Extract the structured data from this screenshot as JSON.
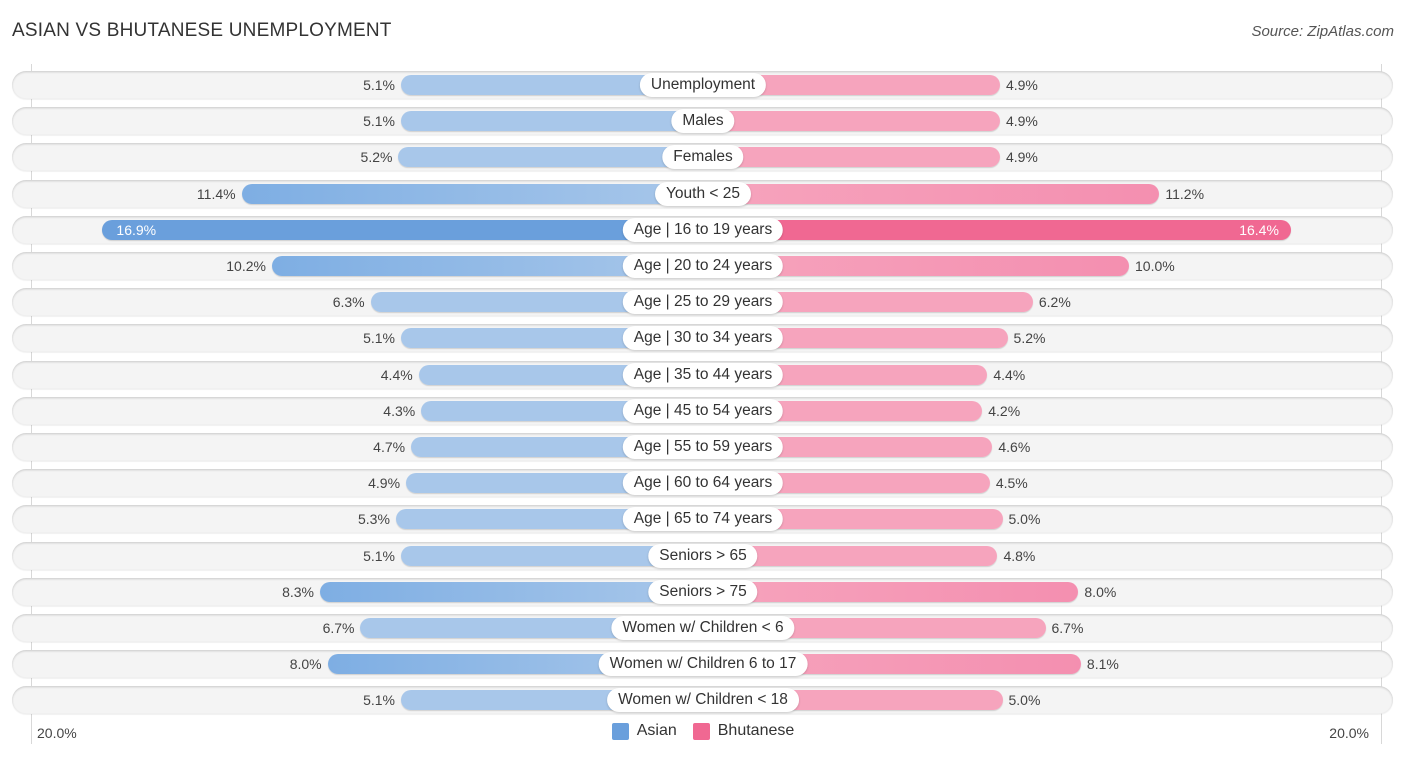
{
  "header": {
    "title": "ASIAN VS BHUTANESE UNEMPLOYMENT",
    "source": "Source: ZipAtlas.com"
  },
  "colors": {
    "asian": "#6a9fdc",
    "asian_light": "#a8c7ea",
    "bhutanese": "#f06892",
    "bhutanese_light": "#f6a4bd"
  },
  "chart_data": {
    "type": "bar",
    "orientation": "horizontal-diverging",
    "title": "ASIAN VS BHUTANESE UNEMPLOYMENT",
    "xlabel": "",
    "ylabel": "",
    "xlim": [
      0,
      20.0
    ],
    "axis_ticks": {
      "left": "20.0%",
      "right": "20.0%"
    },
    "legend": {
      "position": "bottom-center",
      "entries": [
        "Asian",
        "Bhutanese"
      ]
    },
    "categories": [
      "Unemployment",
      "Males",
      "Females",
      "Youth < 25",
      "Age | 16 to 19 years",
      "Age | 20 to 24 years",
      "Age | 25 to 29 years",
      "Age | 30 to 34 years",
      "Age | 35 to 44 years",
      "Age | 45 to 54 years",
      "Age | 55 to 59 years",
      "Age | 60 to 64 years",
      "Age | 65 to 74 years",
      "Seniors > 65",
      "Seniors > 75",
      "Women w/ Children < 6",
      "Women w/ Children 6 to 17",
      "Women w/ Children < 18"
    ],
    "series": [
      {
        "name": "Asian",
        "side": "left",
        "values": [
          5.1,
          5.1,
          5.2,
          11.4,
          16.9,
          10.2,
          6.3,
          5.1,
          4.4,
          4.3,
          4.7,
          4.9,
          5.3,
          5.1,
          8.3,
          6.7,
          8.0,
          5.1
        ],
        "labels": [
          "5.1%",
          "5.1%",
          "5.2%",
          "11.4%",
          "16.9%",
          "10.2%",
          "6.3%",
          "5.1%",
          "4.4%",
          "4.3%",
          "4.7%",
          "4.9%",
          "5.3%",
          "5.1%",
          "8.3%",
          "6.7%",
          "8.0%",
          "5.1%"
        ]
      },
      {
        "name": "Bhutanese",
        "side": "right",
        "values": [
          4.9,
          4.9,
          4.9,
          11.2,
          16.4,
          10.0,
          6.2,
          5.2,
          4.4,
          4.2,
          4.6,
          4.5,
          5.0,
          4.8,
          8.0,
          6.7,
          8.1,
          5.0
        ],
        "labels": [
          "4.9%",
          "4.9%",
          "4.9%",
          "11.2%",
          "16.4%",
          "10.0%",
          "6.2%",
          "5.2%",
          "4.4%",
          "4.2%",
          "4.6%",
          "4.5%",
          "5.0%",
          "4.8%",
          "8.0%",
          "6.7%",
          "8.1%",
          "5.0%"
        ]
      }
    ],
    "highlight_index": 4
  }
}
